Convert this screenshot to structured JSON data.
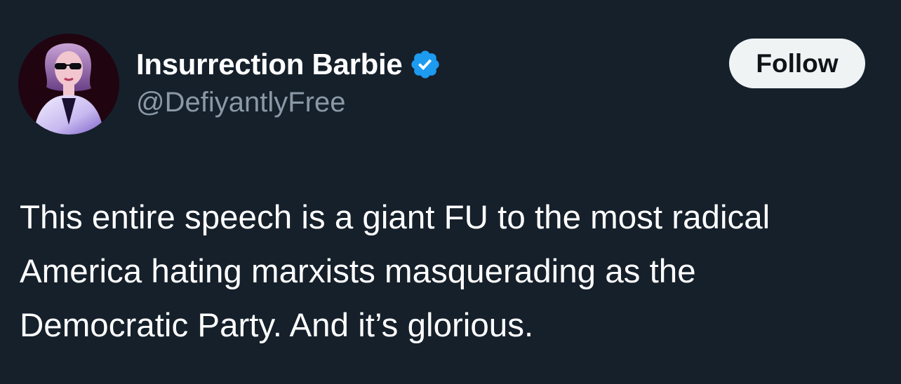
{
  "user": {
    "display_name": "Insurrection Barbie",
    "handle": "@DefiyantlyFree",
    "verified": true,
    "avatar_icon": "profile-photo-woman-sunglasses",
    "verified_icon": "verified-badge-icon"
  },
  "actions": {
    "follow_label": "Follow"
  },
  "tweet": {
    "lines": [
      "This entire speech is a giant FU to the most radical",
      "America hating marxists masquerading as the",
      "Democratic Party. And it’s glorious."
    ]
  },
  "colors": {
    "background": "#15202b",
    "text_primary": "#ffffff",
    "text_secondary": "#8b98a5",
    "verified_blue": "#1d9bf0",
    "follow_button_bg": "#eff3f4",
    "follow_button_text": "#0f1419"
  }
}
